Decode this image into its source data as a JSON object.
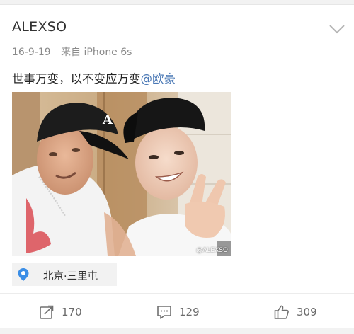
{
  "post": {
    "username": "ALEXSO",
    "date": "16-9-19",
    "source": "来自 iPhone 6s",
    "text_main": "世事万变，以不变应万变",
    "mention": "@欧豪",
    "image_watermark": "@ALEXSO",
    "location": "北京·三里屯"
  },
  "actions": {
    "repost_count": "170",
    "comment_count": "129",
    "like_count": "309"
  },
  "icons": {
    "menu": "chevron-down-icon",
    "location": "location-pin-icon",
    "repost": "repost-icon",
    "comment": "comment-icon",
    "like": "thumbs-up-icon"
  },
  "colors": {
    "mention": "#4a78b5",
    "location_pin": "#3b8ee6"
  }
}
